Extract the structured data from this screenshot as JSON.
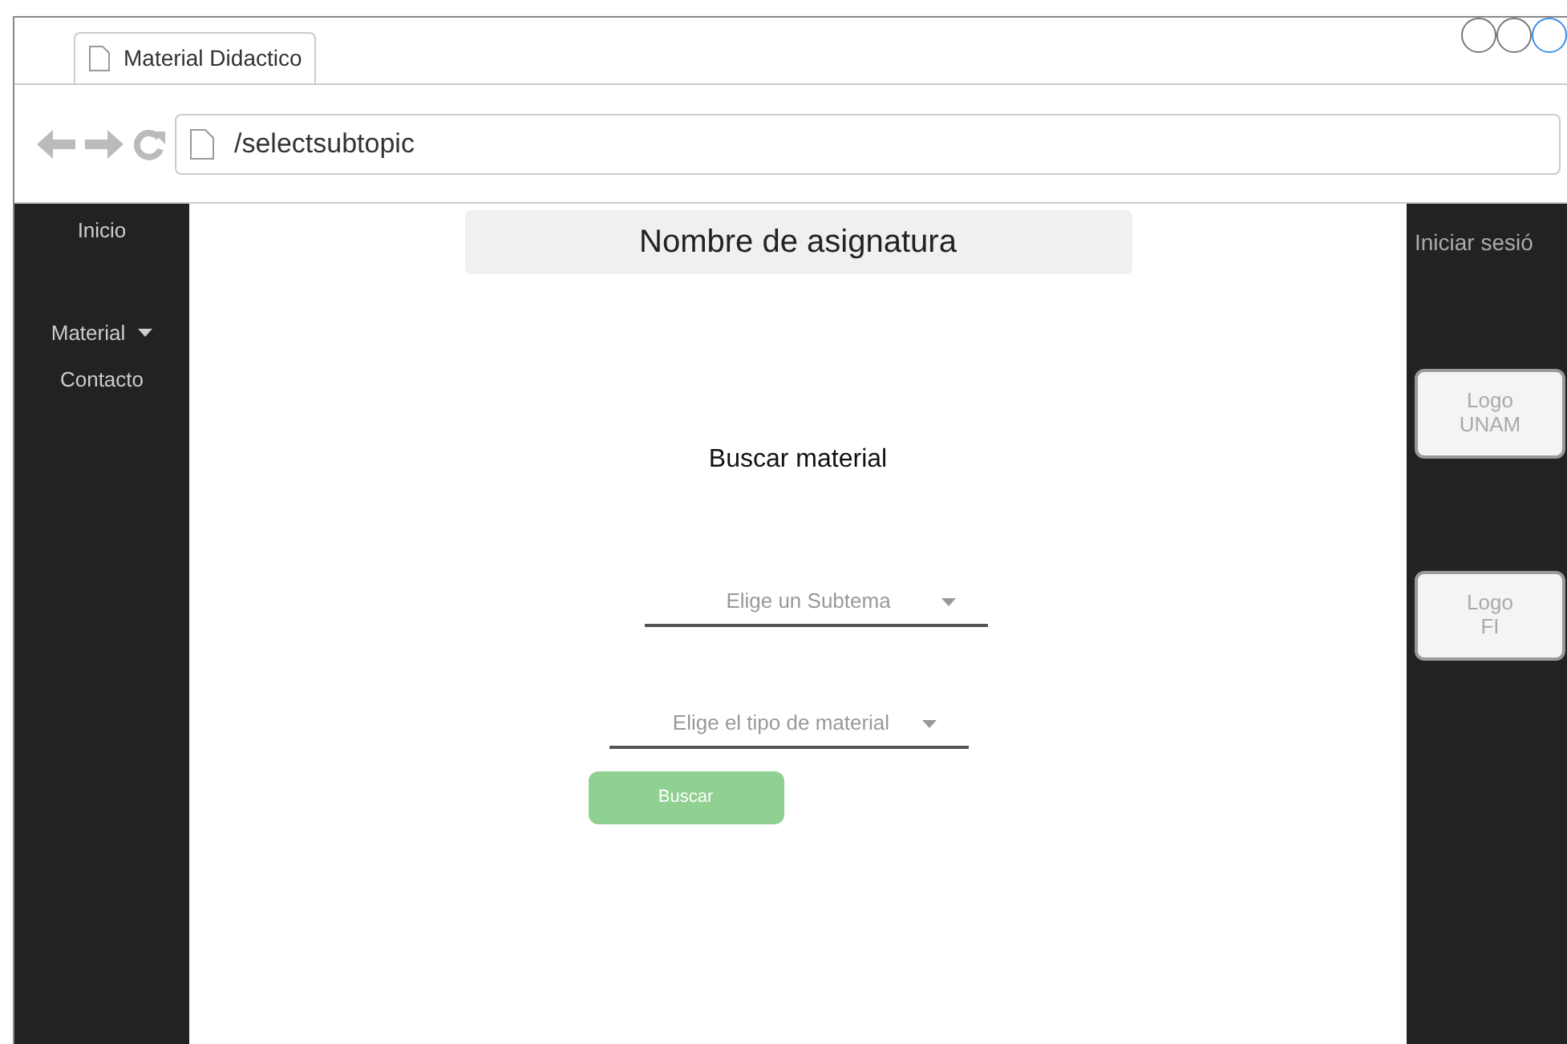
{
  "browser": {
    "tab_title": "Material Didactico",
    "address": "/selectsubtopic"
  },
  "sidebar": {
    "items": [
      {
        "label": "Inicio",
        "has_menu": false
      },
      {
        "label": "Material",
        "has_menu": true
      },
      {
        "label": "Contacto",
        "has_menu": false
      }
    ]
  },
  "header": {
    "title": "Nombre de asignatura"
  },
  "form": {
    "heading": "Buscar material",
    "selects": [
      {
        "placeholder": "Elige un Subtema"
      },
      {
        "placeholder": "Elige el tipo de material"
      }
    ],
    "button": "Buscar"
  },
  "right_panel": {
    "login": "Iniciar sesió",
    "logos": [
      "Logo\nUNAM",
      "Logo\nFI"
    ]
  }
}
